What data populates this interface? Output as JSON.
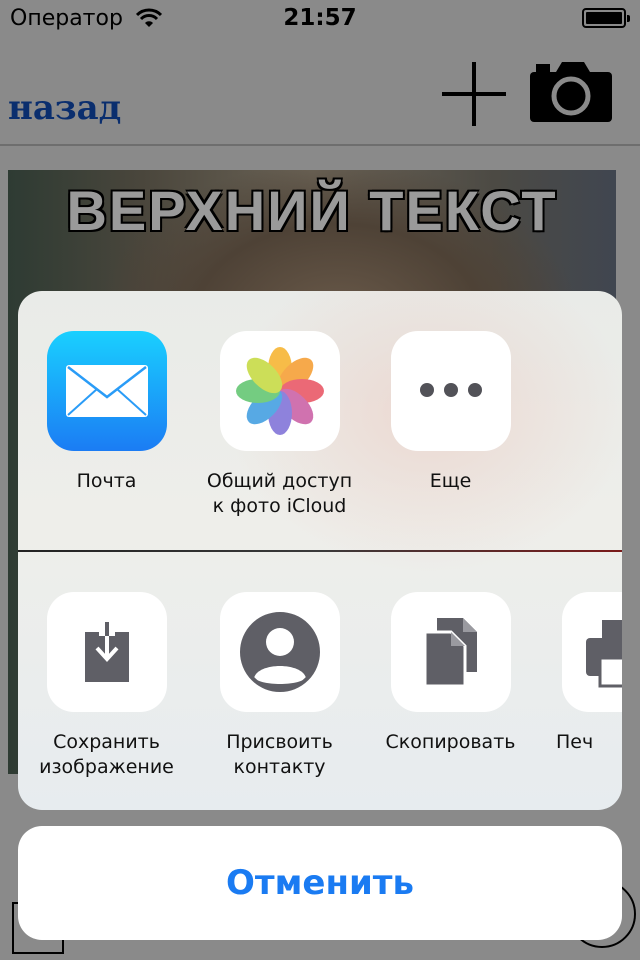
{
  "status_bar": {
    "carrier": "Оператор",
    "time": "21:57"
  },
  "nav": {
    "back_label": "назад",
    "add_icon": "plus-icon",
    "camera_icon": "camera-icon"
  },
  "photo": {
    "top_text": "ВЕРХНИЙ ТЕКСТ"
  },
  "share_sheet": {
    "apps": [
      {
        "label": "Почта",
        "icon": "mail-icon"
      },
      {
        "label_line1": "Общий доступ",
        "label_line2": "к фото iCloud",
        "icon": "photos-icon"
      },
      {
        "label": "Еще",
        "icon": "more-icon"
      }
    ],
    "actions": [
      {
        "label_line1": "Сохранить",
        "label_line2": "изображение",
        "icon": "save-image-icon"
      },
      {
        "label_line1": "Присвоить",
        "label_line2": "контакту",
        "icon": "contact-icon"
      },
      {
        "label": "Скопировать",
        "icon": "copy-icon"
      },
      {
        "label": "Печ",
        "icon": "print-icon"
      }
    ]
  },
  "cancel_label": "Отменить",
  "colors": {
    "accent": "#1a7bf2",
    "back_link": "#0a2e6e",
    "icon_glyph": "#5f5f66"
  }
}
